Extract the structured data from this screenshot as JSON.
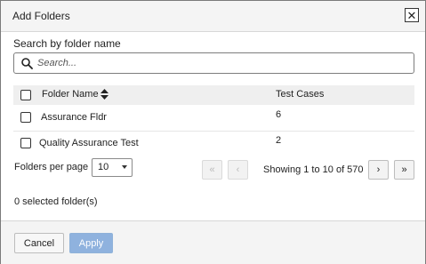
{
  "dialog": {
    "title": "Add Folders",
    "close_glyph": "✕"
  },
  "search": {
    "label": "Search by folder name",
    "placeholder": "Search...",
    "value": ""
  },
  "table": {
    "columns": [
      "Folder Name",
      "Test Cases"
    ],
    "rows": [
      {
        "name": "Assurance Fldr",
        "count": "6"
      },
      {
        "name": "Quality Assurance Test",
        "count": "2"
      }
    ]
  },
  "pagination": {
    "per_page_label": "Folders per page",
    "per_page_value": "10",
    "showing": "Showing 1 to 10 of 570",
    "first_glyph": "«",
    "prev_glyph": "‹",
    "next_glyph": "›",
    "last_glyph": "»"
  },
  "selection": {
    "summary": "0 selected folder(s)"
  },
  "footer": {
    "cancel_label": "Cancel",
    "apply_label": "Apply"
  },
  "colors": {
    "apply_disabled_bg": "#8fb2de",
    "header_bg": "#efefef"
  },
  "icons": [
    "close-icon",
    "search-icon",
    "sort-icon",
    "chevron-down-icon",
    "first-page-icon",
    "prev-page-icon",
    "next-page-icon",
    "last-page-icon"
  ]
}
